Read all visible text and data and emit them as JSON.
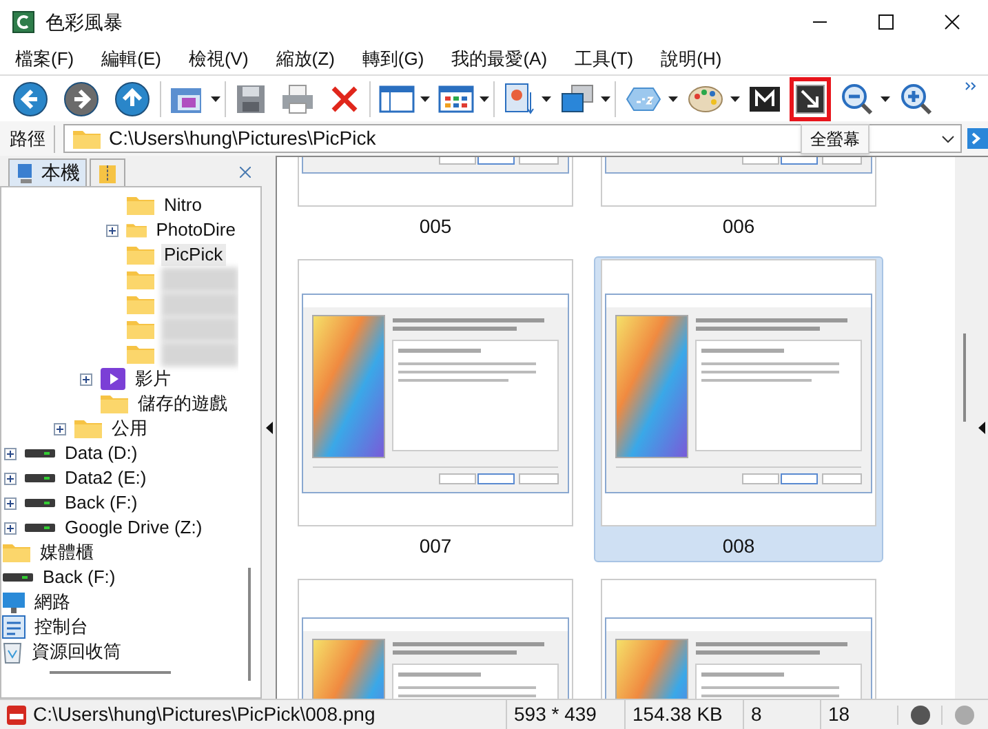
{
  "window": {
    "title": "色彩風暴"
  },
  "menu": [
    "檔案(F)",
    "編輯(E)",
    "檢視(V)",
    "縮放(Z)",
    "轉到(G)",
    "我的最愛(A)",
    "工具(T)",
    "說明(H)"
  ],
  "toolbar": [
    {
      "kind": "back",
      "dropdown": false,
      "highlighted": false
    },
    {
      "kind": "forward",
      "dropdown": false,
      "highlighted": false
    },
    {
      "kind": "up",
      "dropdown": false,
      "highlighted": false
    },
    {
      "kind": "separator"
    },
    {
      "kind": "open",
      "dropdown": true,
      "highlighted": false
    },
    {
      "kind": "separator"
    },
    {
      "kind": "save",
      "dropdown": false,
      "highlighted": false
    },
    {
      "kind": "print",
      "dropdown": false,
      "highlighted": false
    },
    {
      "kind": "delete",
      "dropdown": false,
      "highlighted": false
    },
    {
      "kind": "separator"
    },
    {
      "kind": "layout",
      "dropdown": true,
      "highlighted": false
    },
    {
      "kind": "grid",
      "dropdown": true,
      "highlighted": false
    },
    {
      "kind": "separator"
    },
    {
      "kind": "slideshow",
      "dropdown": true,
      "highlighted": false
    },
    {
      "kind": "windows",
      "dropdown": true,
      "highlighted": false
    },
    {
      "kind": "separator"
    },
    {
      "kind": "sort",
      "dropdown": true,
      "highlighted": false
    },
    {
      "kind": "palette",
      "dropdown": true,
      "highlighted": false
    },
    {
      "kind": "m",
      "dropdown": false,
      "highlighted": false
    },
    {
      "kind": "fullscreen",
      "dropdown": false,
      "highlighted": true
    },
    {
      "kind": "zoom-out",
      "dropdown": true,
      "highlighted": false
    },
    {
      "kind": "zoom-in",
      "dropdown": false,
      "highlighted": false
    }
  ],
  "tooltip": "全螢幕",
  "path_bar": {
    "label": "路徑",
    "value": "C:\\Users\\hung\\Pictures\\PicPick"
  },
  "side_tabs": [
    {
      "label": "本機",
      "kind": "computer",
      "selected": true
    },
    {
      "kind": "archive",
      "selected": false
    }
  ],
  "tree": [
    {
      "children": [
        {
          "children": [
            {
              "children": [
                {
                  "children": [
                    {
                      "label": "Nitro",
                      "kind": "folder",
                      "expandable": false,
                      "selected": false
                    },
                    {
                      "label": "PhotoDire",
                      "kind": "folder",
                      "expandable": true,
                      "selected": false
                    },
                    {
                      "label": "PicPick",
                      "kind": "folder",
                      "expandable": false,
                      "selected": true
                    },
                    {
                      "kind": "redacted"
                    },
                    {
                      "kind": "redacted"
                    },
                    {
                      "kind": "redacted"
                    },
                    {
                      "kind": "redacted"
                    }
                  ]
                },
                {
                  "label": "影片",
                  "kind": "video",
                  "expandable": true,
                  "selected": false
                },
                {
                  "label": "儲存的遊戲",
                  "kind": "folder",
                  "expandable": false,
                  "selected": false
                }
              ]
            },
            {
              "label": "公用",
              "kind": "folder",
              "expandable": true,
              "selected": false
            }
          ]
        },
        {
          "label": "Data (D:)",
          "kind": "drive",
          "expandable": true,
          "selected": false
        },
        {
          "label": "Data2 (E:)",
          "kind": "drive",
          "expandable": true,
          "selected": false
        },
        {
          "label": "Back (F:)",
          "kind": "drive",
          "expandable": true,
          "selected": false
        },
        {
          "label": "Google Drive (Z:)",
          "kind": "drive",
          "expandable": true,
          "selected": false
        }
      ]
    },
    {
      "label": "媒體櫃",
      "kind": "folder",
      "expandable": false,
      "selected": false
    },
    {
      "label": "Back (F:)",
      "kind": "drive",
      "expandable": false,
      "selected": false
    },
    {
      "label": "網路",
      "kind": "network",
      "expandable": false,
      "selected": false
    },
    {
      "label": "控制台",
      "kind": "control-panel",
      "expandable": false,
      "selected": false
    },
    {
      "label": "資源回收筒",
      "kind": "recycle-bin",
      "expandable": false,
      "selected": false
    }
  ],
  "thumbnails": [
    {
      "label": "005",
      "selected": false
    },
    {
      "label": "006",
      "selected": false
    },
    {
      "label": "007",
      "selected": false
    },
    {
      "label": "008",
      "selected": true
    },
    {
      "selected": false
    },
    {
      "selected": false
    }
  ],
  "status_bar": {
    "path": "C:\\Users\\hung\\Pictures\\PicPick\\008.png",
    "dimensions": "593 * 439",
    "size": "154.38 KB",
    "index": "8",
    "count": "18"
  }
}
